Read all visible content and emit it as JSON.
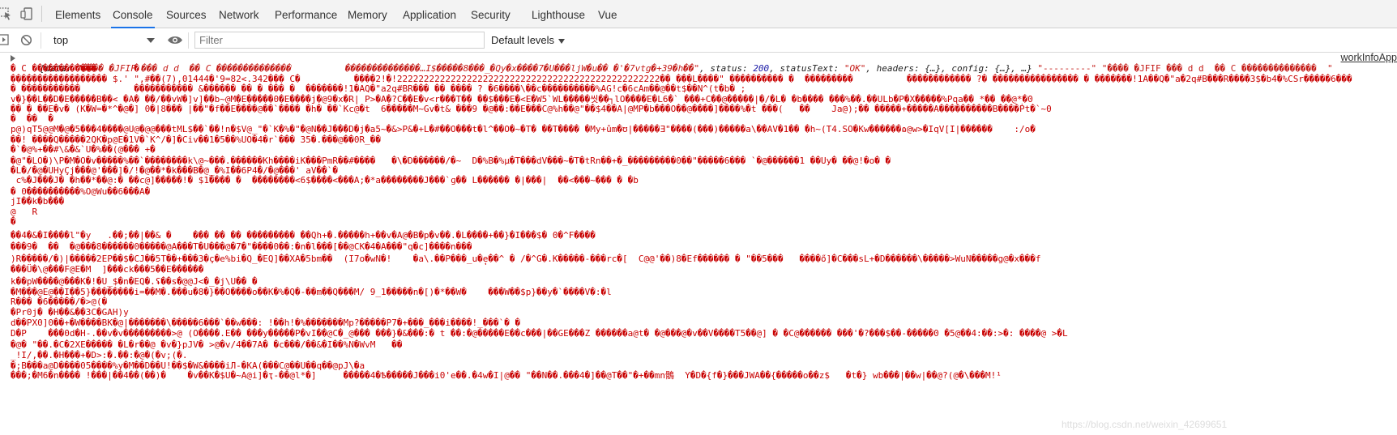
{
  "tabs": [
    {
      "label": "Elements",
      "active": false
    },
    {
      "label": "Console",
      "active": true
    },
    {
      "label": "Sources",
      "active": false
    },
    {
      "label": "Network",
      "active": false
    },
    {
      "label": "Performance",
      "active": false
    },
    {
      "label": "Memory",
      "active": false
    },
    {
      "label": "Application",
      "active": false
    },
    {
      "label": "Security",
      "active": false
    },
    {
      "label": "Lighthouse",
      "active": false
    },
    {
      "label": "Vue",
      "active": false
    }
  ],
  "toolbar": {
    "context": "top",
    "filter_placeholder": "Filter",
    "levels_label": "Default levels"
  },
  "console": {
    "source_link": "workInfoApp",
    "first_line_parts": {
      "p1": "{data: ",
      "data_value": "\"���� �JFIF ��� d d  �� C ��������������          ��������������…I$�����8���_�Qy�x����7�U���ljW�u�� �'�7vtg�+39�h��\"",
      "p2": ", status: ",
      "status_value": "200",
      "p3": ", statusText: ",
      "status_text_value": "\"OK\"",
      "p4": ", headers: {…}, config: {…}, …} ",
      "p5": "\"---------\" \"���� �JFIF ��� d d  �� C ��������������  \""
    },
    "lines": [
      "� C ������������       �",
      "������������������ $.' \",#��(7),01444�'9=82<.342��� C�          ����2!�!2222222222222222222222222222222222222222222222222�� ���L����\" ���������� �  ���������          ������������ ?� ���������������� � �������!1A��Q�\"a�2q#B���R����3$�b4�%CSr�����6���",
      "� �����������          ����������� &������ �� � ��� �  �������!1�AQ�\"a2q#BR��� �� ���� ? �6����\\��c����������%AG!c�6cAm��@��t$��N^(t�b� ;",
      "v�}��L��D�E�����B��< �A� ��/��vW�]v]��b~@M�E�����0�E����j�@9�x�R| P>�A�?C��E�v<r���T�� ��$���E�<E�W5`WL�����씻��┐lO����E�L6�` ���+C��@�����|�/�L� �b���� ���%��.��ULb�P�X�����%Pqa�� *�� ��@*�0",
      "�� � ��E�v� (K�W=�*^�@�] 0�|8��� |��\"�f��E����@��`���� �h� ��`Kc@�t  6�����M~Gv�t& ���9 �@��:��E���C@%h��@\"��$4��A|@MP�b���O��@����]����%�t ���(   ��    Ja@);�� �����+�����A����������B����Ṗt�`~0",
      "�  ��  �",
      "p@)qT5@@M�@�5���4����@U@�@@���tML$��`��!n�$V@_\"�`K�%�\"�@N��J���D�j�a5~�&>P&�+L�#��O���t�l^��O�~�T� ��T���� �My+ûm�ʊ|�����Ǝ\"����(���)�����a\\��AV�1�� �h~(T4.SO�Kw������ɷ@w>�IqV[I|������    :/o�",
      "��! ����Q�����2QK�p@E�1V�`K^/�]�Civ��1�5��%UO�4�r`��� 35�.���@��0R_��",
      "�`�@%+��#\\&�&`U�%��(@��� +�",
      "�@\"�LO�)\\P�M�O�v�����%��`��������k\\@~���.������Kh����iK���PmR��#����   �\\�D������/�~  D�%B�%µ�T���dV���~�T�tRn��+�_���������0��\"�����6��� `�@������1 ��Uy� ��@!�o� �",
      "�L�/�@�UHyÇj���@'���]�/!�@��*�k���B�@_�%I��6P4�/�@���' aV��`�",
      " c%�J���J� �h��*��@:� ��c@]�����!� $1���� �  ��������<6$����<���A;�*a��������J���`ɡ�� L������ �|���|  ��<���~��� � �b",
      "� 0����������%O@Wu��6���A�",
      "jI��k�b���",
      "@   R",
      "�",
      "��4�&�I����l\"�y   .��;��|��& �    ��� �� �� ��������� ��Qh+�.�����h+��v�A@�B�p�v��.�L����+��}�I���$� 0�^F����",
      "���9�  ��  �@���8������0�����@A���T�U���@�7�\"����0��:�n�l���[��@CK�4�A���\"q�c]����n���",
      ")R�����/�)|�����2EP��$�CJ��5T��+���3�ç�e%bi�Q_�EQ]��XA�5bm��  (I7o�wN�!    �a\\.��P���_u�e̘��^ � /�^G�.K�����-���rc�[  C@@'��)8�Ef������ � \"��5���   ����ő]�C���sL+�D������\\�����>WuN�����g@�x���f",
      "���Ü�\\@���F@E�M  ]���ck���5��E������",
      "k��pW����@���K�!�U_$�n�EQ�.ʢ��s�@@J<�_�j\\U�� �",
      "�M���@E@��I��5}��������i=��M�.���u�8�}��O����o��K�%�Q�-��m��Q���M/ 9_1�����n�[)�*��W�    ���W��$p}��y�`����V�:�l",
      "R��� �6�����/�>@(�",
      "�Pr0j� �H��&��3C�GAH)y",
      "d��PX0]0��+�W����BK�@|�������\\�����6���`��w���: !��h!�%�������Mp?�����P7�+���_���i����!_���`� �",
      "D�P    ���0d�H-.��v�v���������>@ (O����.E�� ���y�����P�vI��@C�_@��� ���}�&���:� t ��:�@�����E��c���|��GE���Z ������a@t� �@���@�v��V����T5��@] � �C@������ ���'�?���$��-�����0 �5@��4:��:>�: ����@ >�L",
      "�@� \"��.�C�2XE����� �L�r��@ �v�}pJV� >@�v/4��7A� �c���/��&�I��%N�WvM   ��",
      "_!I/,��.�H���+�D>:�.��:�@�(�v;(�.",
      "�;B���a@D����05����%y�M��D��U!��$�W&����iЛ-�KA(���C@��U��q��@pJ\\�a",
      "���;�M6�n���� !���|��4��(��)�    �v��K�$U�~A@i]�ҭ-��@l*�]     �����4�Ѣ�����J���i0'e��.�4w�I|@�� \"��N��.���4�]��@T��\"�+��mn鶻  Y�D�{f�}���JWA��{�����o��z$   �t�} wb���|��w|��@?(@�\\���M!¹"
    ],
    "watermark": "https://blog.csdn.net/weixin_42699651"
  }
}
